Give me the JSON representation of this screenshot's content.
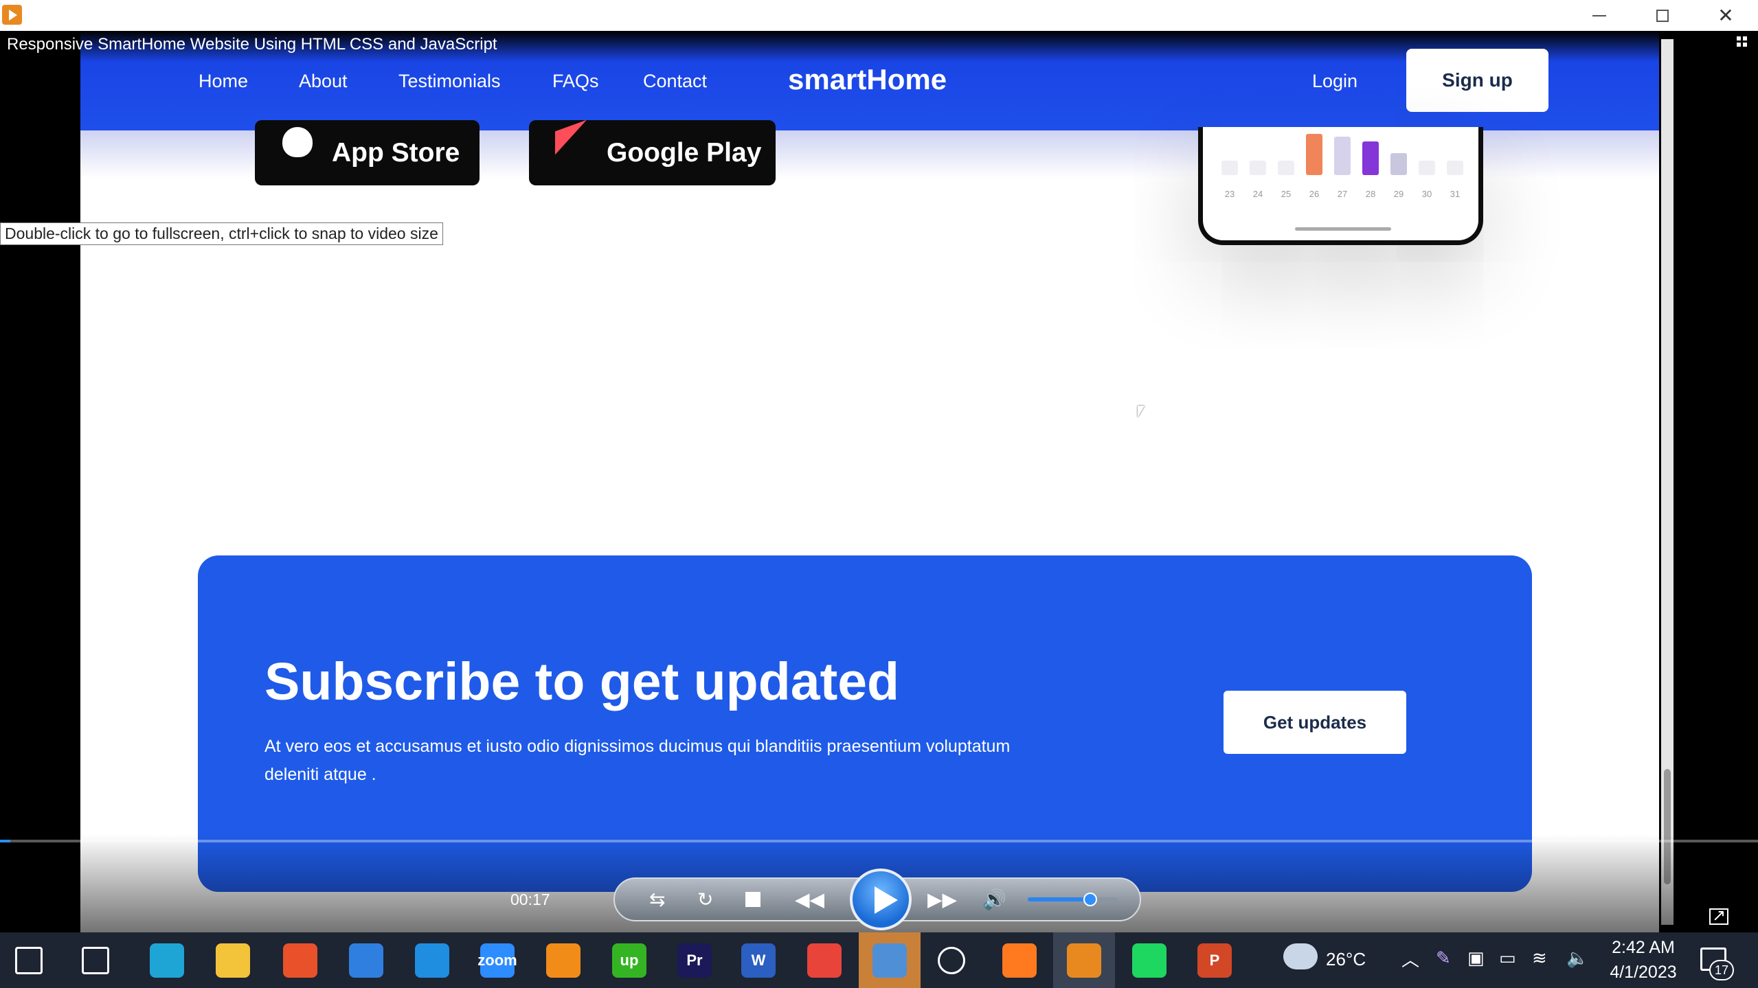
{
  "window": {
    "app_icon": "media-player-icon"
  },
  "video": {
    "title": "Responsive SmartHome Website Using HTML CSS and JavaScript",
    "tooltip": "Double-click to go to fullscreen, ctrl+click to snap to video size",
    "time": "00:17",
    "progress": 0.006,
    "volume": 0.69
  },
  "site": {
    "nav": {
      "links": [
        "Home",
        "About",
        "Testimonials",
        "FAQs",
        "Contact"
      ],
      "brand": "smartHome",
      "login": "Login",
      "signup": "Sign up"
    },
    "stores": {
      "apple": "App Store",
      "google": "Google Play"
    },
    "phone": {
      "days": [
        "23",
        "24",
        "25",
        "26",
        "27",
        "28",
        "29",
        "30",
        "31"
      ],
      "bar_levels": [
        0.3,
        0.3,
        0.3,
        0.85,
        0.8,
        0.7,
        0.45,
        0.3,
        0.3
      ],
      "bar_colors": [
        "#eeeef3",
        "#eeeef3",
        "#eeeef3",
        "#f0855a",
        "#d6d2ec",
        "#8436d8",
        "#c9c6e0",
        "#eeeef3",
        "#eeeef3"
      ]
    },
    "subscribe": {
      "title": "Subscribe to get updated",
      "description": "At vero eos et accusamus et iusto odio dignissimos ducimus qui blanditiis praesentium voluptatum deleniti atque .",
      "button": "Get updates"
    },
    "accent_color": "#1f5be8"
  },
  "taskbar": {
    "apps": [
      {
        "name": "start-icon",
        "color": "#ffffff"
      },
      {
        "name": "task-view-icon",
        "color": "#ffffff"
      },
      {
        "name": "edge-icon",
        "color": "#1ea5d6"
      },
      {
        "name": "file-explorer-icon",
        "color": "#f3c33a"
      },
      {
        "name": "microsoft-store-icon",
        "color": "#e8512a"
      },
      {
        "name": "mail-icon",
        "color": "#2f7fe0"
      },
      {
        "name": "vscode-icon",
        "color": "#1f8ee0"
      },
      {
        "name": "zoom-icon",
        "color": "#2d8cff"
      },
      {
        "name": "sublime-text-icon",
        "color": "#f28c18"
      },
      {
        "name": "upwork-icon",
        "color": "#35b423"
      },
      {
        "name": "premiere-pro-icon",
        "color": "#1b1958"
      },
      {
        "name": "word-icon",
        "color": "#2b5fc1"
      },
      {
        "name": "chrome-icon",
        "color": "#e8443a"
      },
      {
        "name": "photos-icon",
        "color": "#4f8fd6"
      },
      {
        "name": "settings-icon",
        "color": "#ffffff"
      },
      {
        "name": "firefox-icon",
        "color": "#ff7a1f"
      },
      {
        "name": "media-player-icon",
        "color": "#e88920"
      },
      {
        "name": "spotify-icon",
        "color": "#1ed760"
      },
      {
        "name": "powerpoint-icon",
        "color": "#d24726"
      }
    ],
    "app_labels": {
      "zoom": "zoom",
      "upwork": "up",
      "premiere": "Pr",
      "word": "W",
      "powerpoint": "P"
    },
    "weather": "26°C",
    "time": "2:42 AM",
    "date": "4/1/2023",
    "notifications": "17"
  }
}
